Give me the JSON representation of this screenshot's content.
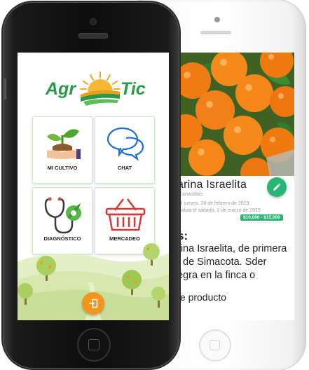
{
  "front_app": {
    "logo": {
      "left_text": "Agr",
      "right_text": "Tic"
    },
    "tiles": [
      {
        "label": "MI CULTIVO",
        "icon": "plant-hands-icon"
      },
      {
        "label": "CHAT",
        "icon": "chat-bubbles-icon"
      },
      {
        "label": "DIAGNÓSTICO",
        "icon": "stethoscope-leaf-icon"
      },
      {
        "label": "MERCADEO",
        "icon": "shopping-basket-icon"
      }
    ],
    "exit_icon": "exit-icon"
  },
  "back_app": {
    "product_title": "arina Israelita",
    "product_subtitle": "Canastillas",
    "date_line_1": "el jueves, 28 de febrero de 2019",
    "date_line_2": "naliza el sábado, 2 de marzo de 2019",
    "price_range": "$10,000 - $15,000",
    "section_label": "s:",
    "description_lines": [
      "rina Israelita, de primera",
      ", de Simacota. Sder",
      "egra en la finca o"
    ],
    "description_footer": "te producto",
    "edit_icon": "pencil-icon"
  },
  "colors": {
    "brand_green": "#2a9a4a",
    "accent_green": "#27b673",
    "accent_orange": "#f3941c"
  }
}
